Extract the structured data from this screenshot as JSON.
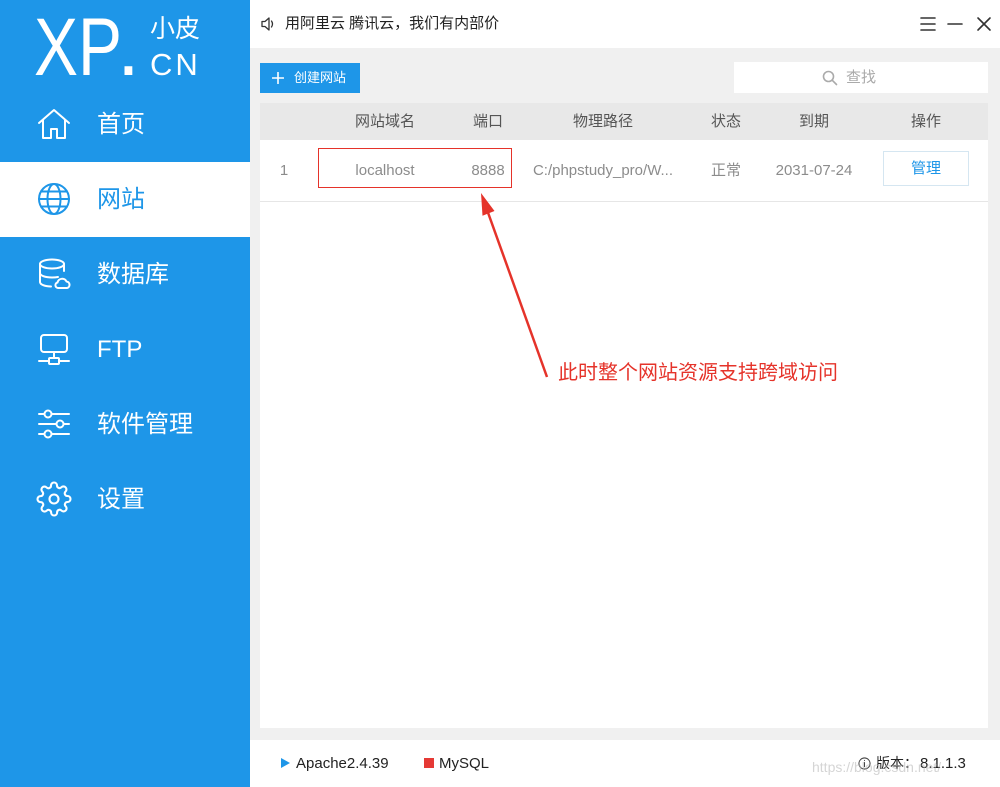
{
  "window": {
    "ad_icon": "speaker-icon",
    "ad_text": "用阿里云 腾讯云，我们有内部价",
    "controls": [
      "menu-icon",
      "minimize-icon",
      "close-icon"
    ]
  },
  "logo": {
    "main": "XP",
    "dot": ".",
    "cn_top": "小皮",
    "cn_bottom": "CN"
  },
  "colors": {
    "brand": "#1e96e8",
    "annotation": "#e5332a",
    "mysql_indicator": "#e53935"
  },
  "sidebar": {
    "active_index": 1,
    "items": [
      {
        "label": "首页",
        "icon": "home-icon"
      },
      {
        "label": "网站",
        "icon": "globe-icon"
      },
      {
        "label": "数据库",
        "icon": "database-icon"
      },
      {
        "label": "FTP",
        "icon": "monitor-icon"
      },
      {
        "label": "软件管理",
        "icon": "sliders-icon"
      },
      {
        "label": "设置",
        "icon": "gear-icon"
      }
    ]
  },
  "toolbar": {
    "create_icon": "plus-icon",
    "create_label": "创建网站",
    "search_icon": "search-icon",
    "search_placeholder": "查找"
  },
  "table": {
    "headers": {
      "domain": "网站域名",
      "port": "端口",
      "path": "物理路径",
      "status": "状态",
      "expiry": "到期",
      "action": "操作"
    },
    "rows": [
      {
        "index": "1",
        "domain": "localhost",
        "port": "8888",
        "path": "C:/phpstudy_pro/W...",
        "status": "正常",
        "expiry": "2031-07-24",
        "action": "管理"
      }
    ]
  },
  "annotation": {
    "text": "此时整个网站资源支持跨域访问"
  },
  "statusbar": {
    "services": [
      {
        "name": "Apache2.4.39",
        "icon": "play-icon"
      },
      {
        "name": "MySQL",
        "icon": "stop-icon"
      }
    ],
    "version_icon": "info-icon",
    "version_label": "版本：",
    "version": "8.1.1.3"
  },
  "watermark": "https://blog.csdn.net/"
}
